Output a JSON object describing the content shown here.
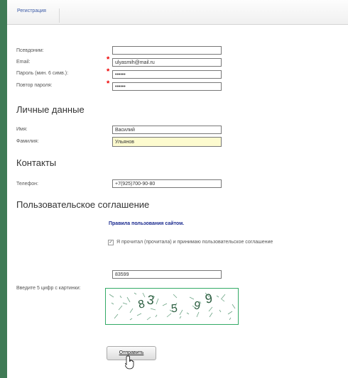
{
  "tab": {
    "label": "Регистрация"
  },
  "account": {
    "nickname_label": "Псевдоним:",
    "nickname_value": "",
    "email_label": "Email:",
    "email_value": "ulyasmih@mail.ru",
    "password_label": "Пароль (мин. 6 симв.):",
    "password_value": "••••••",
    "repeat_label": "Повтор пароля:",
    "repeat_value": "••••••"
  },
  "personal": {
    "heading": "Личные данные",
    "name_label": "Имя:",
    "name_value": "Василий",
    "surname_label": "Фамилия:",
    "surname_value": "Ульянов"
  },
  "contacts": {
    "heading": "Контакты",
    "phone_label": "Телефон:",
    "phone_value": "+7(925)700-90-80"
  },
  "agreement": {
    "heading": "Пользовательское соглашение",
    "rules_link": "Правила пользования сайтом.",
    "accept_text": "Я прочитал (прочитала) и принимаю пользовательское соглашение"
  },
  "captcha": {
    "label": "Введите 5 цифр с картинки:",
    "value": "83599",
    "image_digits": "83599"
  },
  "submit": {
    "label": "Отправить"
  },
  "colors": {
    "required": "#ee0000",
    "link": "#1a2a8f",
    "highlight": "#fdfbcf"
  }
}
